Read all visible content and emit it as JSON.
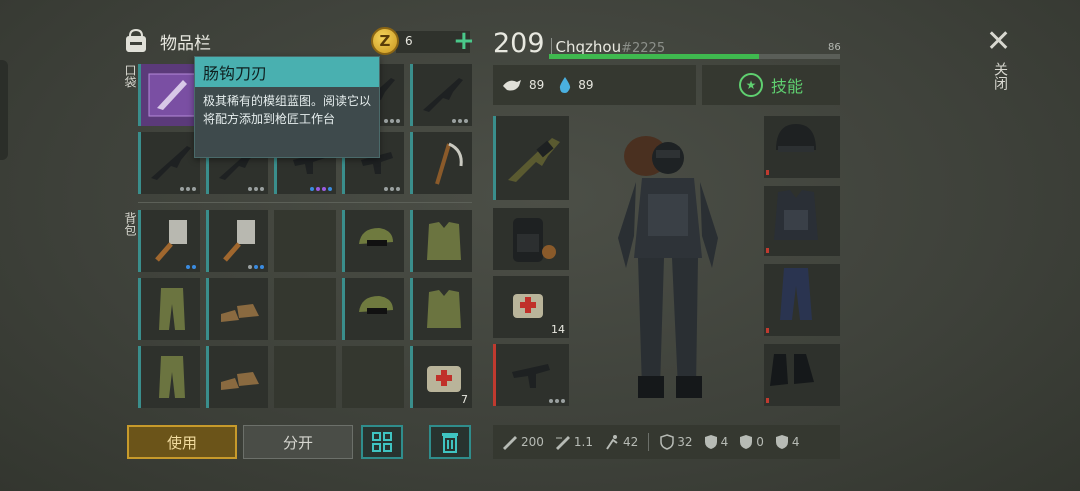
{
  "inventory": {
    "title": "物品栏",
    "coins": "6",
    "pocket_label": "口袋",
    "backpack_label": "背包"
  },
  "tooltip": {
    "title": "肠钩刀刃",
    "description": "极其稀有的模组蓝图。阅读它以将配方添加到枪匠工作台"
  },
  "stacks": {
    "medkit_backpack": "7",
    "medkit_equip": "14"
  },
  "buttons": {
    "use": "使用",
    "split": "分开"
  },
  "player": {
    "level": "209",
    "name": "Chqzhou",
    "tag": "#2225",
    "xp_value": "86",
    "xp_fraction": 0.72,
    "food": "89",
    "water": "89",
    "skills_label": "技能"
  },
  "combat_stats": {
    "damage": "200",
    "attack_speed": "1.1",
    "move_speed": "42",
    "armor": "32",
    "cold_resist": "4",
    "radiation": "0",
    "bio": "4"
  },
  "close_label": "关闭",
  "colors": {
    "accent_teal": "#3a8e8c",
    "gold": "#c79a2b",
    "skill_green": "#5fd070",
    "xp_green": "#3fb94f"
  }
}
